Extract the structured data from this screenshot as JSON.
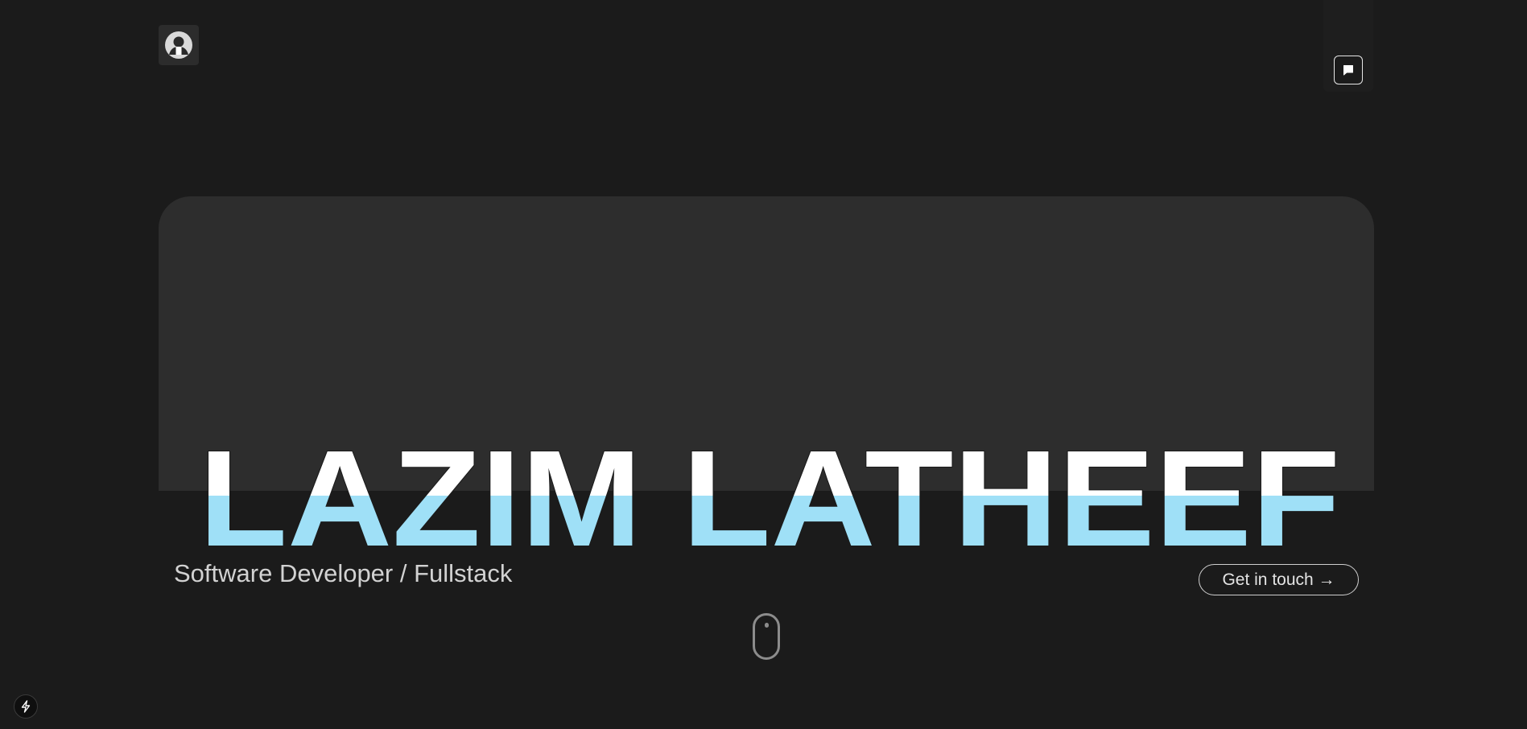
{
  "header": {
    "avatar_icon": "user-portrait-icon",
    "chat_icon": "chat-bubble-icon"
  },
  "hero": {
    "name": "LAZIM LATHEEF",
    "subtitle": "Software Developer / Fullstack",
    "cta_label": "Get in touch →",
    "scroll_icon": "mouse-scroll-icon"
  },
  "footer": {
    "badge_icon": "lightning-bolt-icon"
  },
  "colors": {
    "background": "#1b1b1b",
    "card": "#2d2d2d",
    "name_top": "#ffffff",
    "name_bottom": "#9fe0f7"
  }
}
